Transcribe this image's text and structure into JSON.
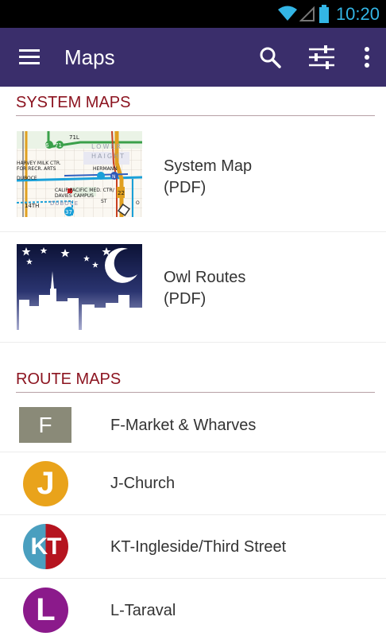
{
  "status": {
    "time": "10:20"
  },
  "appbar": {
    "title": "Maps",
    "menu_icon": "hamburger-menu-icon",
    "search_icon": "search-icon",
    "filter_icon": "sliders-icon",
    "overflow_icon": "more-vertical-icon",
    "color": "#3a2e6b"
  },
  "system_maps": {
    "header": "SYSTEM MAPS",
    "items": [
      {
        "title": "System Map",
        "subtitle": "(PDF)"
      },
      {
        "title": "Owl Routes",
        "subtitle": "(PDF)"
      }
    ],
    "map_thumb_labels": {
      "l1": "6",
      "l2": "71",
      "l3": "71L",
      "l4": "LOWER",
      "l5": "HAIGHT",
      "l6": "HARVEY MILK CTR.",
      "l7": "FOR RECR. ARTS",
      "l8": "HERMANN",
      "l9": "DUBOCE",
      "l10": "CALIF PACIFIC MED. CTR/",
      "l11": "DAVIES CAMPUS",
      "l12": "14TH",
      "l13": "DUBOCE",
      "l14": "37",
      "l15": "ST",
      "l16": "22",
      "l17": "N",
      "l18": "O"
    }
  },
  "route_maps": {
    "header": "ROUTE MAPS",
    "items": [
      {
        "badge": "F",
        "name": "F-Market & Wharves",
        "color": "#8a8a78"
      },
      {
        "badge": "J",
        "name": "J-Church",
        "color": "#e9a31b"
      },
      {
        "badge": "KT",
        "name": "KT-Ingleside/Third Street",
        "color_left": "#4a9fbf",
        "color_right": "#b5141f"
      },
      {
        "badge": "L",
        "name": "L-Taraval",
        "color": "#8b1a8b"
      }
    ]
  }
}
